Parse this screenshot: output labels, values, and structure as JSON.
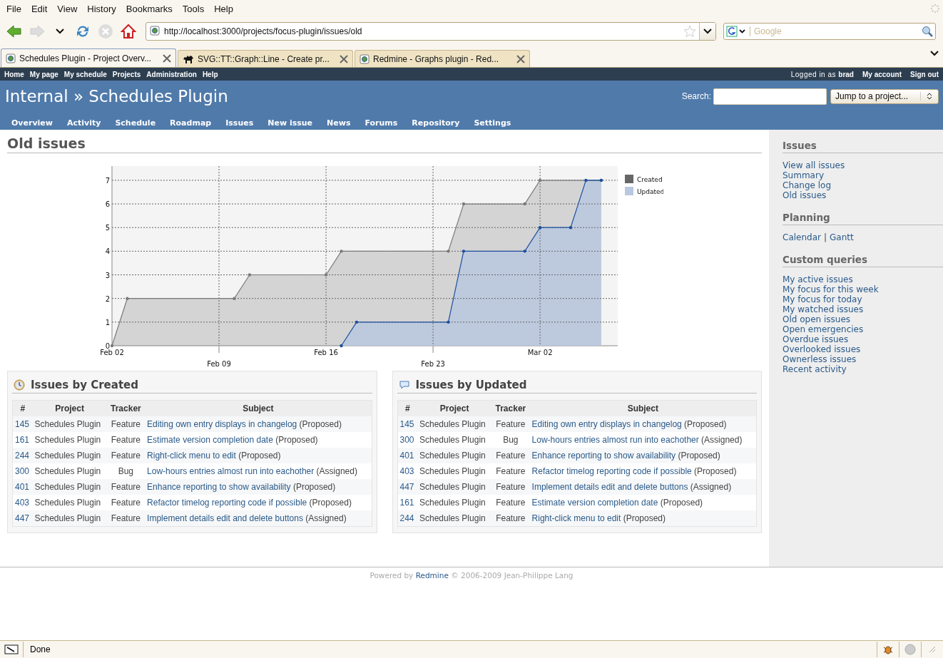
{
  "browser": {
    "menu": [
      "File",
      "Edit",
      "View",
      "History",
      "Bookmarks",
      "Tools",
      "Help"
    ],
    "url": "http://localhost:3000/projects/focus-plugin/issues/old",
    "search_placeholder": "Google",
    "tabs": [
      {
        "title": "Schedules Plugin - Project Overv...",
        "selected": true
      },
      {
        "title": "SVG::TT::Graph::Line - Create pr...",
        "selected": false
      },
      {
        "title": "Redmine - Graphs plugin - Red...",
        "selected": false
      }
    ],
    "status": "Done"
  },
  "top_menu": [
    "Home",
    "My page",
    "My schedule",
    "Projects",
    "Administration",
    "Help"
  ],
  "logged_in": "Logged in as **brad**",
  "account_menu": [
    "My account",
    "Sign out"
  ],
  "header": {
    "title": "Internal » Schedules Plugin",
    "search_label": "Search:",
    "jump": "Jump to a project..."
  },
  "main_menu": [
    "Overview",
    "Activity",
    "Schedule",
    "Roadmap",
    "Issues",
    "New issue",
    "News",
    "Forums",
    "Repository",
    "Settings"
  ],
  "content": {
    "heading": "Old issues",
    "chart_data": {
      "type": "area",
      "categories": [
        "Feb 02",
        null,
        null,
        null,
        null,
        null,
        null,
        "Feb 09",
        null,
        null,
        null,
        null,
        null,
        null,
        "Feb 16",
        null,
        null,
        null,
        null,
        null,
        null,
        "Feb 23",
        null,
        null,
        null,
        null,
        null,
        null,
        "Mar 02",
        null,
        null,
        null,
        null
      ],
      "series": [
        {
          "name": "Created",
          "color": "#666666",
          "values": [
            0,
            2,
            2,
            2,
            2,
            2,
            2,
            2,
            2,
            3,
            3,
            3,
            3,
            3,
            3,
            4,
            4,
            4,
            4,
            4,
            4,
            4,
            4,
            6,
            6,
            6,
            6,
            6,
            7,
            7,
            7,
            7,
            7
          ]
        },
        {
          "name": "Updated",
          "color": "#b8c8df",
          "values": [
            null,
            null,
            null,
            null,
            null,
            null,
            null,
            null,
            null,
            null,
            null,
            null,
            null,
            null,
            null,
            0,
            1,
            1,
            1,
            1,
            1,
            1,
            1,
            4,
            4,
            4,
            4,
            4,
            5,
            5,
            5,
            7,
            7
          ]
        }
      ],
      "grid": true,
      "legend": "right",
      "ylim": [
        0,
        7.6
      ],
      "yticks": [
        0,
        1,
        2,
        3,
        4,
        5,
        6,
        7
      ]
    },
    "panels": [
      {
        "title": "Issues by Created",
        "columns": [
          "#",
          "Project",
          "Tracker",
          "Subject"
        ],
        "rows": [
          {
            "id": "145",
            "project": "Schedules Plugin",
            "tracker": "Feature",
            "subject": "Editing own entry displays in changelog",
            "status": "(Proposed)"
          },
          {
            "id": "161",
            "project": "Schedules Plugin",
            "tracker": "Feature",
            "subject": "Estimate version completion date",
            "status": "(Proposed)"
          },
          {
            "id": "244",
            "project": "Schedules Plugin",
            "tracker": "Feature",
            "subject": "Right-click menu to edit",
            "status": "(Proposed)"
          },
          {
            "id": "300",
            "project": "Schedules Plugin",
            "tracker": "Bug",
            "subject": "Low-hours entries almost run into eachother",
            "status": "(Assigned)"
          },
          {
            "id": "401",
            "project": "Schedules Plugin",
            "tracker": "Feature",
            "subject": "Enhance reporting to show availability",
            "status": "(Proposed)"
          },
          {
            "id": "403",
            "project": "Schedules Plugin",
            "tracker": "Feature",
            "subject": "Refactor timelog reporting code if possible",
            "status": "(Proposed)"
          },
          {
            "id": "447",
            "project": "Schedules Plugin",
            "tracker": "Feature",
            "subject": "Implement details edit and delete buttons",
            "status": "(Assigned)"
          }
        ]
      },
      {
        "title": "Issues by Updated",
        "columns": [
          "#",
          "Project",
          "Tracker",
          "Subject"
        ],
        "rows": [
          {
            "id": "145",
            "project": "Schedules Plugin",
            "tracker": "Feature",
            "subject": "Editing own entry displays in changelog",
            "status": "(Proposed)"
          },
          {
            "id": "300",
            "project": "Schedules Plugin",
            "tracker": "Bug",
            "subject": "Low-hours entries almost run into eachother",
            "status": "(Assigned)"
          },
          {
            "id": "401",
            "project": "Schedules Plugin",
            "tracker": "Feature",
            "subject": "Enhance reporting to show availability",
            "status": "(Proposed)"
          },
          {
            "id": "403",
            "project": "Schedules Plugin",
            "tracker": "Feature",
            "subject": "Refactor timelog reporting code if possible",
            "status": "(Proposed)"
          },
          {
            "id": "447",
            "project": "Schedules Plugin",
            "tracker": "Feature",
            "subject": "Implement details edit and delete buttons",
            "status": "(Assigned)"
          },
          {
            "id": "161",
            "project": "Schedules Plugin",
            "tracker": "Feature",
            "subject": "Estimate version completion date",
            "status": "(Proposed)"
          },
          {
            "id": "244",
            "project": "Schedules Plugin",
            "tracker": "Feature",
            "subject": "Right-click menu to edit",
            "status": "(Proposed)"
          }
        ]
      }
    ]
  },
  "sidebar": [
    {
      "title": "Issues",
      "kind": "list",
      "items": [
        {
          "kind": "link",
          "text": "View all issues"
        },
        {
          "kind": "link",
          "text": "Summary"
        },
        {
          "kind": "link",
          "text": "Change log"
        },
        {
          "kind": "link",
          "text": "Old issues"
        }
      ]
    },
    {
      "title": "Planning",
      "kind": "inline",
      "items": [
        {
          "kind": "link",
          "text": "Calendar"
        },
        {
          "kind": "separator",
          "text": "|"
        },
        {
          "kind": "link",
          "text": "Gantt"
        }
      ]
    },
    {
      "title": "Custom queries",
      "kind": "list",
      "items": [
        {
          "kind": "link",
          "text": "My active issues"
        },
        {
          "kind": "link",
          "text": "My focus for this week"
        },
        {
          "kind": "link",
          "text": "My focus for today"
        },
        {
          "kind": "link",
          "text": "My watched issues"
        },
        {
          "kind": "link",
          "text": "Old open issues"
        },
        {
          "kind": "link",
          "text": "Open emergencies"
        },
        {
          "kind": "link",
          "text": "Overdue issues"
        },
        {
          "kind": "link",
          "text": "Overlooked issues"
        },
        {
          "kind": "link",
          "text": "Ownerless issues"
        },
        {
          "kind": "link",
          "text": "Recent activity"
        }
      ]
    }
  ],
  "footer": {
    "prefix": "Powered by",
    "link": "Redmine",
    "suffix": "© 2006-2009 Jean-Philippe Lang"
  }
}
